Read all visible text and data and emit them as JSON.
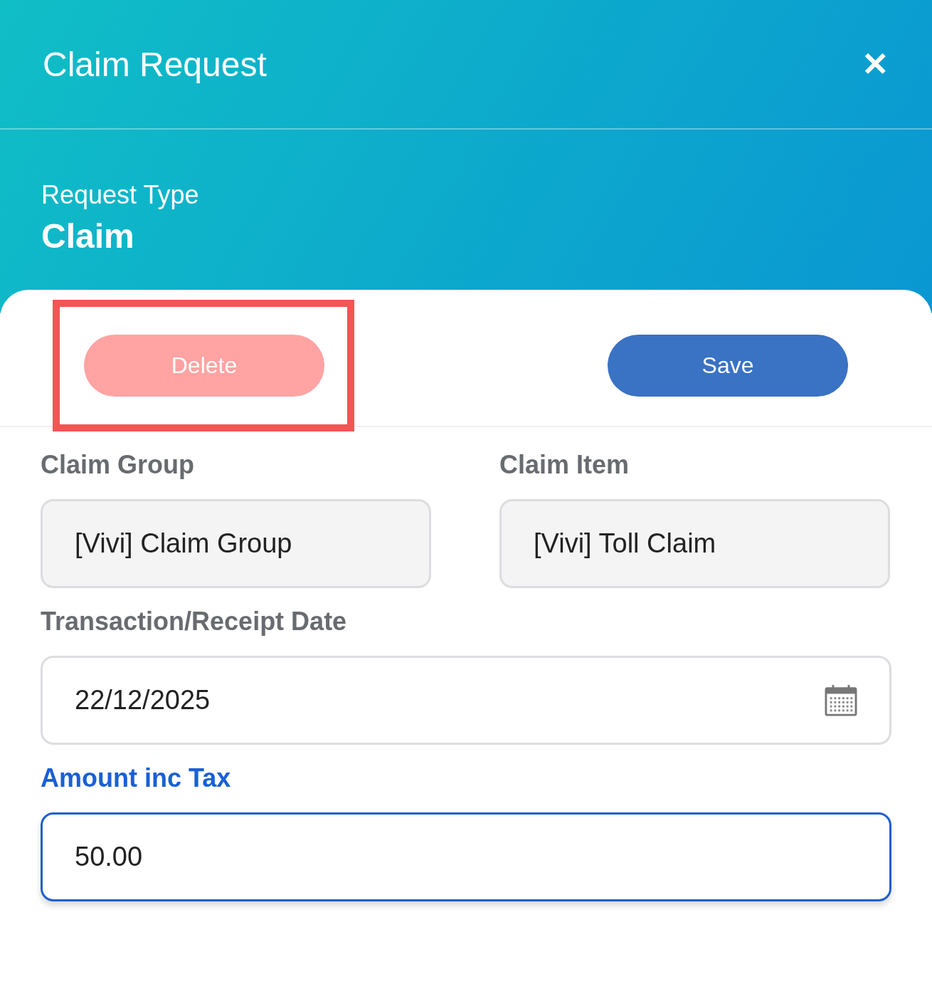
{
  "header": {
    "title": "Claim Request",
    "close_icon": "✕"
  },
  "request_type": {
    "label": "Request Type",
    "value": "Claim"
  },
  "actions": [
    {
      "kind": "delete",
      "label": "Delete",
      "disabled": true,
      "highlighted": true
    },
    {
      "kind": "save",
      "label": "Save",
      "disabled": false,
      "highlighted": false
    }
  ],
  "fields": [
    {
      "kind": "select",
      "label": "Claim Group",
      "value": "[Vivi] Claim Group",
      "focused": false
    },
    {
      "kind": "select",
      "label": "Claim Item",
      "value": "[Vivi] Toll Claim",
      "focused": false
    },
    {
      "kind": "date",
      "label": "Transaction/Receipt Date",
      "value": "22/12/2025",
      "focused": false
    },
    {
      "kind": "text",
      "label": "Amount inc Tax",
      "value": "50.00",
      "focused": true
    }
  ]
}
